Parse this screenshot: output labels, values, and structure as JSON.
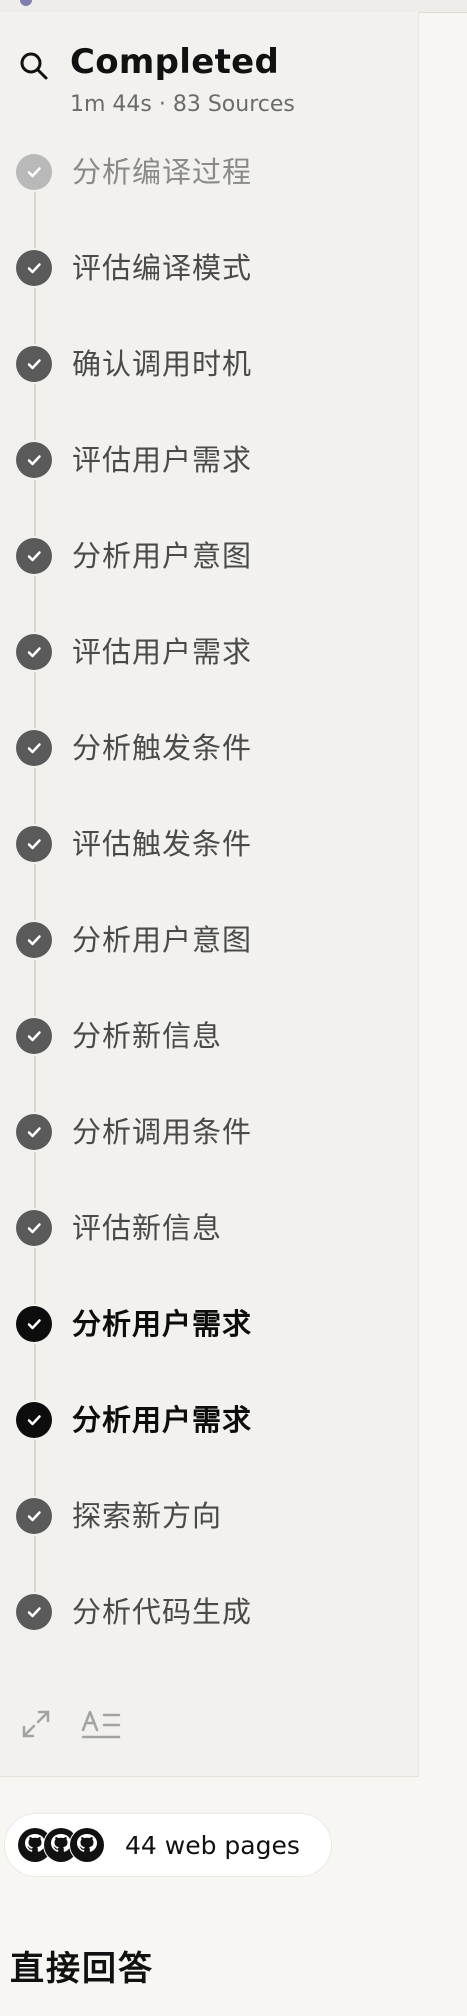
{
  "header": {
    "title": "Completed",
    "meta": "1m 44s · 83 Sources"
  },
  "steps": [
    {
      "label": "分析编译过程",
      "state": "faded"
    },
    {
      "label": "评估编译模式",
      "state": "done"
    },
    {
      "label": "确认调用时机",
      "state": "done"
    },
    {
      "label": "评估用户需求",
      "state": "done"
    },
    {
      "label": "分析用户意图",
      "state": "done"
    },
    {
      "label": "评估用户需求",
      "state": "done"
    },
    {
      "label": "分析触发条件",
      "state": "done"
    },
    {
      "label": "评估触发条件",
      "state": "done"
    },
    {
      "label": "分析用户意图",
      "state": "done"
    },
    {
      "label": "分析新信息",
      "state": "done"
    },
    {
      "label": "分析调用条件",
      "state": "done"
    },
    {
      "label": "评估新信息",
      "state": "done"
    },
    {
      "label": "分析用户需求",
      "state": "active"
    },
    {
      "label": "分析用户需求",
      "state": "active"
    },
    {
      "label": "探索新方向",
      "state": "done"
    },
    {
      "label": "分析代码生成",
      "state": "done"
    }
  ],
  "sources": {
    "label": "44 web pages",
    "icon_names": [
      "github-logo-icon",
      "github-logo-icon",
      "github-logo-icon"
    ]
  },
  "answer": {
    "title": "直接回答"
  },
  "colors": {
    "panel_background": "#f2f1ed",
    "page_background": "#f7f6f2",
    "check_done": "#5a5a5a",
    "check_active": "#0d0d0d",
    "check_faded": "#b9b9b9",
    "timeline": "#d9d6d1",
    "text_dark": "#111111",
    "text_muted": "#6b6b6b"
  },
  "icons": {
    "header": "search-icon",
    "step": "checkmark-icon",
    "tools": [
      "expand-icon",
      "text-format-icon"
    ]
  }
}
